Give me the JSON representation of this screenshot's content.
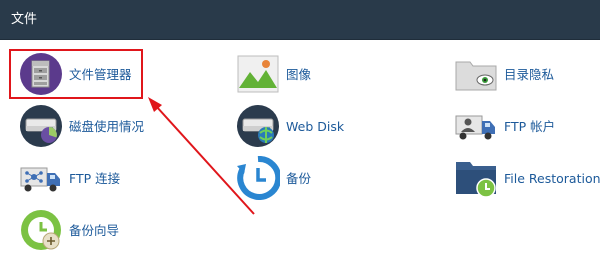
{
  "panel": {
    "title": "文件"
  },
  "items": {
    "file_manager": {
      "label": "文件管理器",
      "icon": "file-cabinet-icon"
    },
    "images": {
      "label": "图像",
      "icon": "image-landscape-icon"
    },
    "directory_privacy": {
      "label": "目录隐私",
      "icon": "folder-eye-icon"
    },
    "disk_usage": {
      "label": "磁盘使用情况",
      "icon": "disk-pie-icon"
    },
    "web_disk": {
      "label": "Web Disk",
      "icon": "disk-globe-icon"
    },
    "ftp_accounts": {
      "label": "FTP 帐户",
      "icon": "ftp-truck-user-icon"
    },
    "ftp_connections": {
      "label": "FTP 连接",
      "icon": "ftp-truck-network-icon"
    },
    "backup": {
      "label": "备份",
      "icon": "backup-clock-icon"
    },
    "file_restoration": {
      "label": "File Restoration",
      "icon": "folder-restore-icon"
    },
    "backup_wizard": {
      "label": "备份向导",
      "icon": "backup-wizard-icon"
    }
  },
  "annotation": {
    "highlight_color": "#e0161b"
  },
  "colors": {
    "header_bg": "#293a4a",
    "link": "#1d5a9a"
  }
}
